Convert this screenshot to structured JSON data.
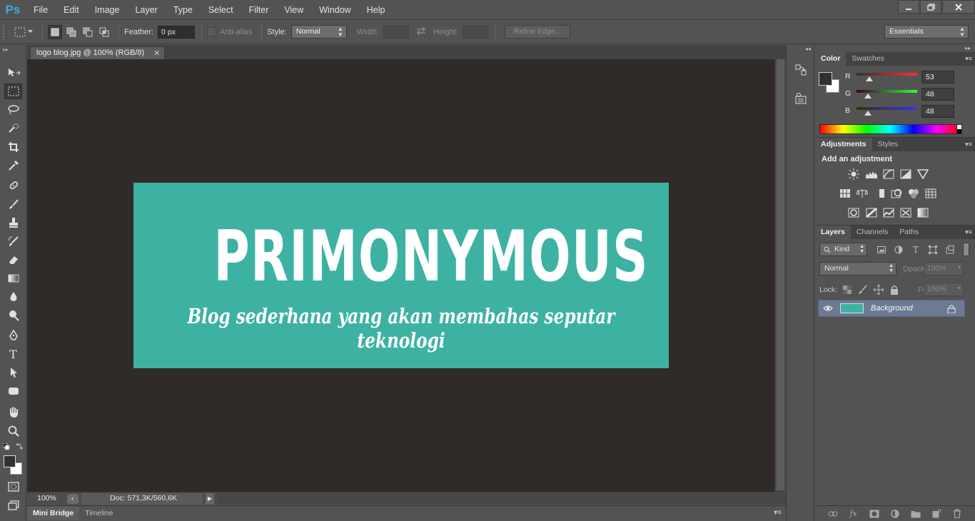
{
  "app": {
    "logo": "Ps",
    "menu": [
      "File",
      "Edit",
      "Image",
      "Layer",
      "Type",
      "Select",
      "Filter",
      "View",
      "Window",
      "Help"
    ],
    "window_controls": [
      "minimize",
      "restore",
      "close"
    ]
  },
  "options_bar": {
    "feather_label": "Feather:",
    "feather_value": "0 px",
    "anti_alias_label": "Anti-alias",
    "style_label": "Style:",
    "style_value": "Normal",
    "width_label": "Width:",
    "height_label": "Height:",
    "refine_label": "Refine Edge...",
    "workspace_value": "Essentials"
  },
  "toolbox": {
    "tools": [
      "move-tool",
      "rectangular-marquee-tool",
      "lasso-tool",
      "quick-selection-tool",
      "crop-tool",
      "eyedropper-tool",
      "spot-healing-tool",
      "brush-tool",
      "clone-stamp-tool",
      "history-brush-tool",
      "eraser-tool",
      "gradient-tool",
      "blur-tool",
      "dodge-tool",
      "pen-tool",
      "type-tool",
      "path-selection-tool",
      "rectangle-tool",
      "hand-tool",
      "zoom-tool"
    ],
    "active_tool": "rectangular-marquee-tool",
    "foreground_color": "#353030",
    "background_color": "#ffffff"
  },
  "document": {
    "tab_title": "logo blog.jpg @ 100% (RGB/8)",
    "canvas_background": "#302b29",
    "image": {
      "background_color": "#3db2a3",
      "title": "PRIMONYMOUS",
      "tagline": "Blog sederhana yang akan membahas seputar teknologi"
    },
    "zoom": "100%",
    "doc_info": "Doc: 571,3K/560,6K"
  },
  "bottom_panel": {
    "tabs": [
      "Mini Bridge",
      "Timeline"
    ],
    "active_tab": "Mini Bridge"
  },
  "color_panel": {
    "tabs": [
      "Color",
      "Swatches"
    ],
    "active_tab": "Color",
    "channels": [
      {
        "label": "R",
        "value": "53",
        "fraction": 0.208,
        "track": "linear-gradient(to right, #353030, #ff3030)"
      },
      {
        "label": "G",
        "value": "48",
        "fraction": 0.188,
        "track": "linear-gradient(to right, #350030, #35ff30)"
      },
      {
        "label": "B",
        "value": "48",
        "fraction": 0.188,
        "track": "linear-gradient(to right, #353000, #3530ff)"
      }
    ]
  },
  "adjustments_panel": {
    "tabs": [
      "Adjustments",
      "Styles"
    ],
    "active_tab": "Adjustments",
    "title": "Add an adjustment",
    "icons": [
      [
        "brightness-contrast-icon",
        "levels-icon",
        "curves-icon",
        "exposure-icon",
        "vibrance-icon"
      ],
      [
        "hue-saturation-icon",
        "color-balance-icon",
        "black-white-icon",
        "photo-filter-icon",
        "channel-mixer-icon",
        "color-lookup-icon"
      ],
      [
        "invert-icon",
        "posterize-icon",
        "threshold-icon",
        "selective-color-icon",
        "gradient-map-icon"
      ]
    ]
  },
  "layers_panel": {
    "tabs": [
      "Layers",
      "Channels",
      "Paths"
    ],
    "active_tab": "Layers",
    "filter_kind": "Kind",
    "blend_mode": "Normal",
    "opacity_label": "Opacity:",
    "opacity_value": "100%",
    "lock_label": "Lock:",
    "fill_label": "Fill:",
    "fill_value": "100%",
    "layers": [
      {
        "name": "Background",
        "visible": true,
        "locked": true
      }
    ],
    "footer_icons": [
      "link-layers-icon",
      "fx-icon",
      "add-mask-icon",
      "adjustment-layer-icon",
      "new-group-icon",
      "new-layer-icon",
      "delete-layer-icon"
    ]
  }
}
